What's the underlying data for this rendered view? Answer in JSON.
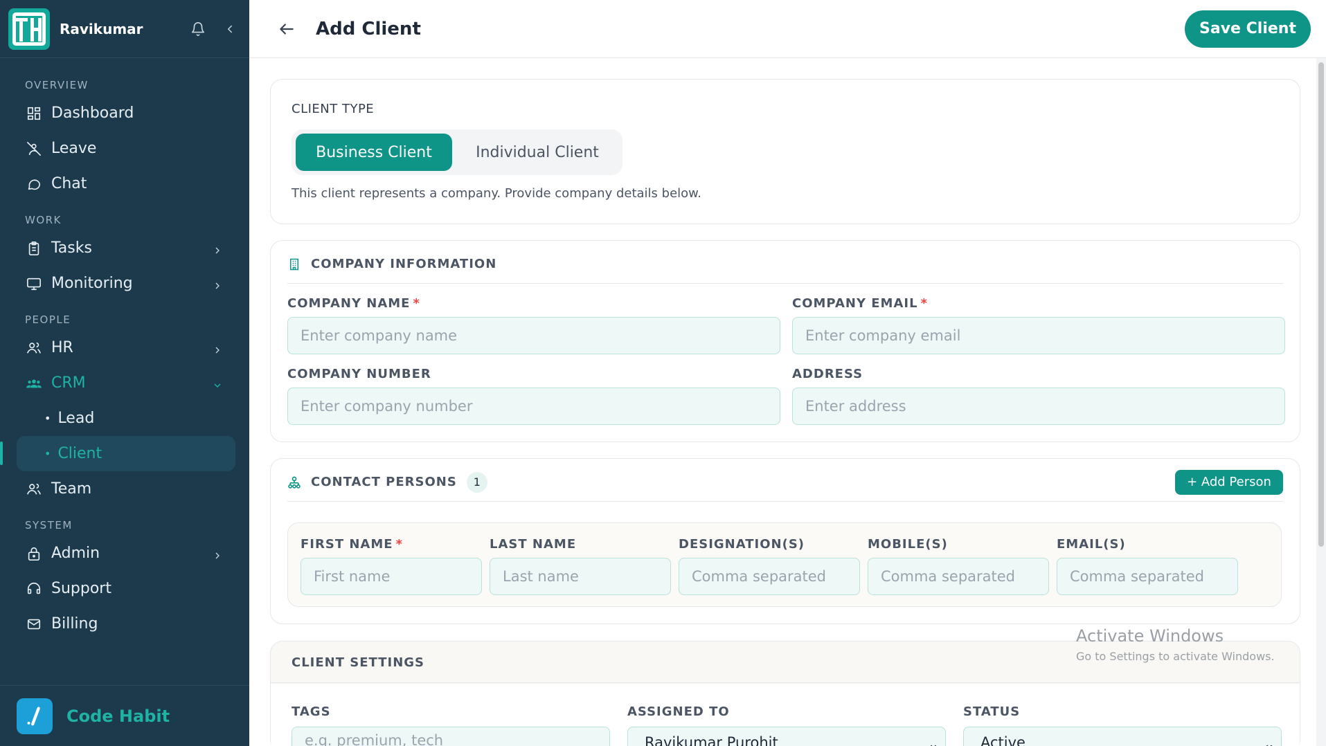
{
  "sidebar": {
    "username": "Ravikumar",
    "sections": {
      "overview": "OVERVIEW",
      "work": "WORK",
      "people": "PEOPLE",
      "system": "SYSTEM"
    },
    "items": {
      "dashboard": "Dashboard",
      "leave": "Leave",
      "chat": "Chat",
      "tasks": "Tasks",
      "monitoring": "Monitoring",
      "hr": "HR",
      "crm": "CRM",
      "lead": "Lead",
      "client": "Client",
      "team": "Team",
      "admin": "Admin",
      "support": "Support",
      "billing": "Billing"
    },
    "footer_name": "Code Habit",
    "accent_color": "#1fb3a5",
    "background_color": "#1c3a4c"
  },
  "header": {
    "title": "Add Client",
    "save_label": "Save Client"
  },
  "client_type": {
    "label": "CLIENT TYPE",
    "options": [
      "Business Client",
      "Individual Client"
    ],
    "selected": "Business Client",
    "help": "This client represents a company. Provide company details below."
  },
  "company_info": {
    "title": "COMPANY INFORMATION",
    "fields": {
      "name_label": "COMPANY NAME",
      "name_placeholder": "Enter company name",
      "email_label": "COMPANY EMAIL",
      "email_placeholder": "Enter company email",
      "number_label": "COMPANY NUMBER",
      "number_placeholder": "Enter company number",
      "address_label": "ADDRESS",
      "address_placeholder": "Enter address"
    },
    "required_mark": "*"
  },
  "contact_persons": {
    "title": "CONTACT PERSONS",
    "count": "1",
    "add_label": "+ Add Person",
    "columns": [
      "FIRST NAME",
      "LAST NAME",
      "DESIGNATION(S)",
      "MOBILE(S)",
      "EMAIL(S)"
    ],
    "placeholders": [
      "First name",
      "Last name",
      "Comma separated",
      "Comma separated",
      "Comma separated"
    ]
  },
  "client_settings": {
    "title": "CLIENT SETTINGS",
    "tags_label": "TAGS",
    "tags_placeholder": "e.g. premium, tech",
    "assigned_label": "ASSIGNED TO",
    "assigned_value": "Ravikumar Purohit",
    "status_label": "STATUS",
    "status_value": "Active"
  },
  "watermark": {
    "line1": "Activate Windows",
    "line2": "Go to Settings to activate Windows."
  },
  "primary_color": "#0f9488"
}
